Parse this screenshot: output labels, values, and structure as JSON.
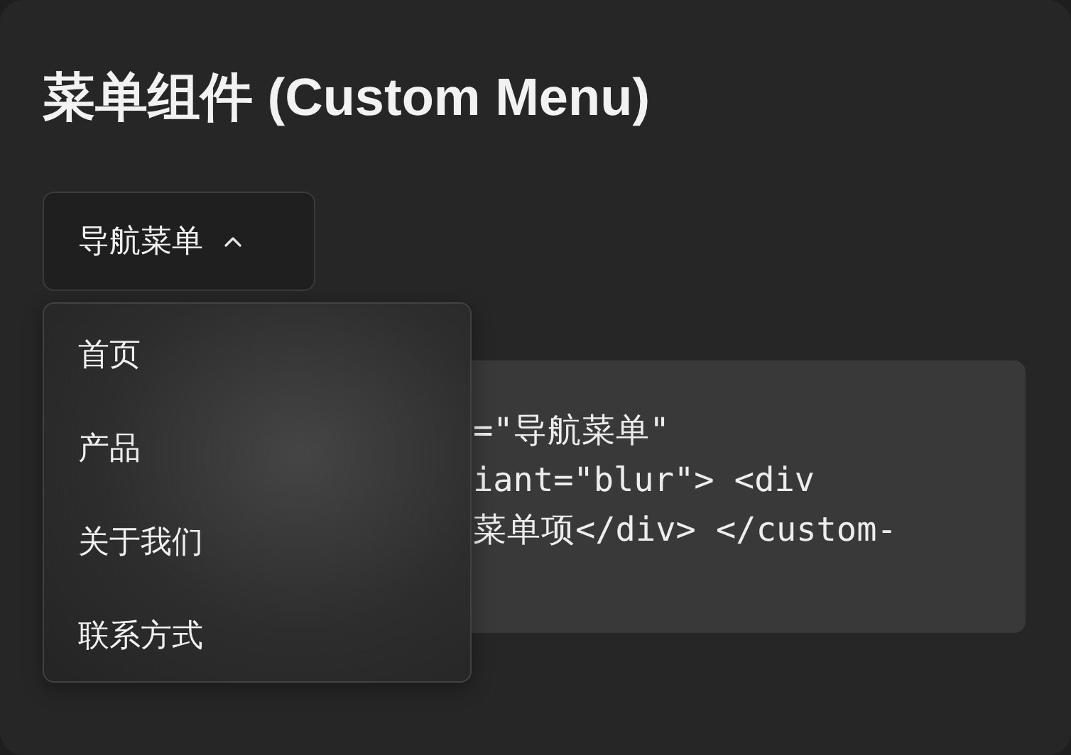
{
  "title": "菜单组件 (Custom Menu)",
  "menu_button": {
    "label": "导航菜单",
    "expanded": true
  },
  "menu_items": [
    {
      "label": "首页"
    },
    {
      "label": "产品"
    },
    {
      "label": "关于我们"
    },
    {
      "label": "联系方式"
    }
  ],
  "code_lines": [
    "=\"导航菜单\"",
    "iant=\"blur\"> <div",
    "菜单项</div> </custom-"
  ]
}
